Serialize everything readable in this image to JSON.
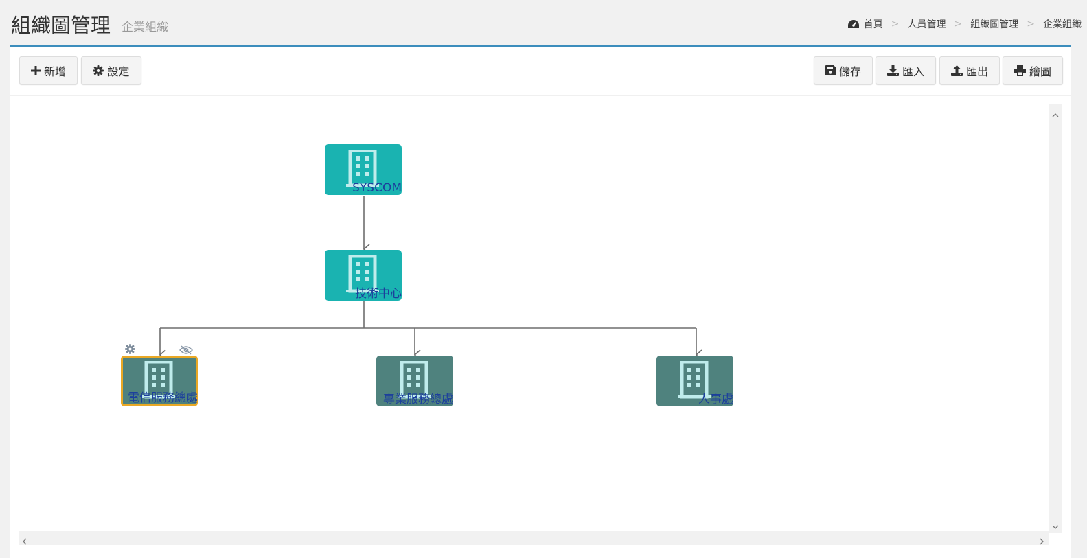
{
  "header": {
    "title": "組織圖管理",
    "subtitle": "企業組織"
  },
  "breadcrumb": {
    "items": [
      "首頁",
      "人員管理",
      "組織圖管理",
      "企業組織"
    ],
    "separator": ">"
  },
  "toolbar": {
    "left": [
      {
        "label": "新增",
        "icon": "plus-icon"
      },
      {
        "label": "設定",
        "icon": "gear-icon"
      }
    ],
    "right": [
      {
        "label": "儲存",
        "icon": "save-icon"
      },
      {
        "label": "匯入",
        "icon": "download-icon"
      },
      {
        "label": "匯出",
        "icon": "upload-icon"
      },
      {
        "label": "繪圖",
        "icon": "print-icon"
      }
    ]
  },
  "org_chart": {
    "nodes": [
      {
        "id": "syscom",
        "label": "SYSCOM",
        "style": "teal",
        "icon": "building-icon"
      },
      {
        "id": "tech",
        "label": "技術中心",
        "style": "teal",
        "icon": "building-icon"
      },
      {
        "id": "telecom",
        "label": "電信服務總處",
        "style": "dark",
        "selected": true,
        "icon": "building-icon"
      },
      {
        "id": "prof",
        "label": "專業服務總處",
        "style": "dark",
        "icon": "building-icon"
      },
      {
        "id": "hr",
        "label": "人事處",
        "style": "dark",
        "icon": "building-icon"
      }
    ],
    "edges": [
      [
        "syscom",
        "tech"
      ],
      [
        "tech",
        "telecom"
      ],
      [
        "tech",
        "prof"
      ],
      [
        "tech",
        "hr"
      ]
    ],
    "selected_node_tools": [
      "gear-icon",
      "eye-slash-icon"
    ]
  },
  "colors": {
    "accent": "#3c8dbc",
    "node_teal": "#1ab3b1",
    "node_dark": "#4f827e",
    "node_selected_border": "#e9a825",
    "node_label": "#1c3f9c"
  }
}
